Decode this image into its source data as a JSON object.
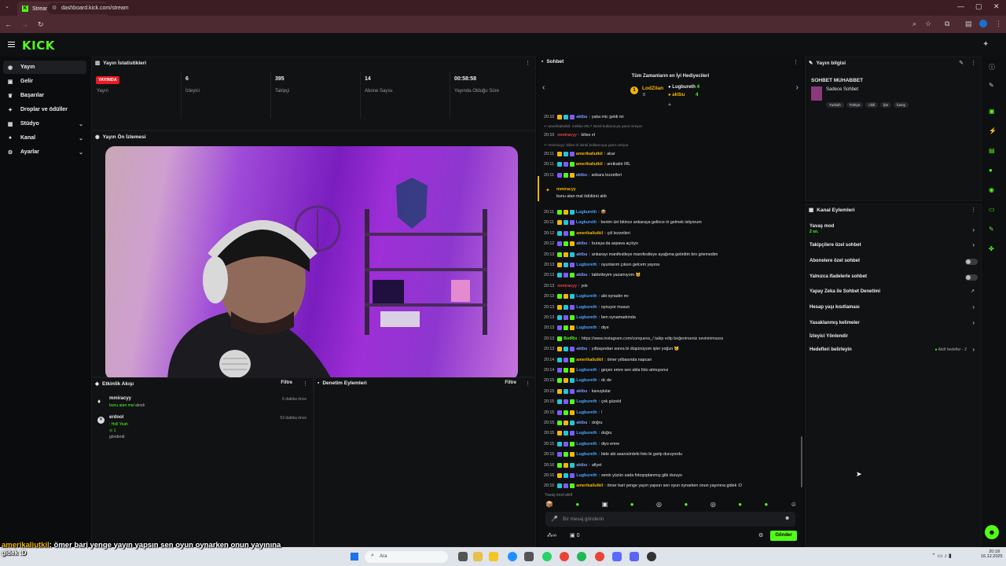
{
  "browser": {
    "tab_title": "Stream - Kick Dashboard",
    "url": "dashboard.kick.com/stream"
  },
  "brand": {
    "logo": "KICK",
    "accent": "#53fc18"
  },
  "sidebar": {
    "items": [
      {
        "label": "Yayın",
        "icon": "broadcast-icon"
      },
      {
        "label": "Gelir",
        "icon": "wallet-icon"
      },
      {
        "label": "Başarılar",
        "icon": "trophy-icon"
      },
      {
        "label": "Droplar ve ödüller",
        "icon": "gift-icon"
      },
      {
        "label": "Stüdyo",
        "icon": "studio-icon"
      },
      {
        "label": "Kanal",
        "icon": "user-icon"
      },
      {
        "label": "Ayarlar",
        "icon": "gear-icon"
      }
    ]
  },
  "stats": {
    "title": "Yayın İstatistikleri",
    "live_badge": "YAYINDA",
    "items": [
      {
        "value": "",
        "label": "Yayın"
      },
      {
        "value": "6",
        "label": "İzleyici"
      },
      {
        "value": "395",
        "label": "Takipçi"
      },
      {
        "value": "14",
        "label": "Abone Sayısı"
      },
      {
        "value": "00:58:58",
        "label": "Yayında Olduğu Süre"
      }
    ]
  },
  "preview": {
    "title": "Yayın Ön İzlemesi"
  },
  "activity": {
    "title": "Etkinlik Akışı",
    "filter": "Filtre",
    "events": [
      {
        "user": "mmiracyy",
        "detail": "bunu atan mal",
        "tail": "alındı",
        "time": "6 dakika önce"
      },
      {
        "user": "erdool",
        "detail": ": Hell Yeah",
        "amount": "1",
        "tail": "gönderdi",
        "time": "53 dakika önce"
      }
    ]
  },
  "moderation": {
    "title": "Denetim Eylemleri",
    "filter": "Filtre"
  },
  "chat": {
    "title": "Sohbet",
    "top_gifters_title": "Tüm Zamanların en İyi Hediyecileri",
    "gifters": [
      {
        "rank": "1",
        "name": "LodZilan",
        "count": "8"
      },
      {
        "name": "Lugbureth",
        "count": "4"
      },
      {
        "name": "aktbu",
        "count": "4"
      }
    ],
    "messages": [
      {
        "t": "20:10",
        "u": "aktbu",
        "c": "#7b9cff",
        "m": "yaka mic geldi mi"
      },
      {
        "sys": "amerikaliutkil: mekke IRL? İsimli kullanıcıya yanıt veriyor"
      },
      {
        "t": "20:10",
        "u": "mmiracyy",
        "c": "#e0433f",
        "m": "kilise ırl"
      },
      {
        "sys": "mmiracyy: kilise irl isimli kullanıcıya yanıt veriyor"
      },
      {
        "t": "20:11",
        "u": "amerikaliutkil",
        "c": "#f2b705",
        "m": "akar"
      },
      {
        "t": "20:11",
        "u": "amerikaliutkil",
        "c": "#f2b705",
        "m": "anıtkabir IRL"
      },
      {
        "t": "20:11",
        "u": "aktbu",
        "c": "#7b9cff",
        "m": "ankara lezzetleri"
      },
      {
        "t": "20:11",
        "u": "Lugbureth",
        "c": "#4aa3ff",
        "m": "📦"
      },
      {
        "t": "20:11",
        "u": "Lugbureth",
        "c": "#4aa3ff",
        "m": "benim ünl bitince ankaraya gelince iri gelmek istiyorum"
      },
      {
        "t": "20:12",
        "u": "amerikaliutkil",
        "c": "#f2b705",
        "m": "çöl lezzetleri"
      },
      {
        "t": "20:12",
        "u": "aktbu",
        "c": "#7b9cff",
        "m": "buraya da aspava açılıyo"
      },
      {
        "t": "20:13",
        "u": "aktbu",
        "c": "#7b9cff",
        "m": "ankarayı manifestleye manıfestleye ayağıma getirdim brn griemedim"
      },
      {
        "t": "20:13",
        "u": "Lugbureth",
        "c": "#4aa3ff",
        "m": "oyunlarım çıksın gelcem yayına"
      },
      {
        "t": "20:13",
        "u": "aktbu",
        "c": "#7b9cff",
        "m": "tabletteyim yazamıyom 🐱"
      },
      {
        "t": "20:13",
        "u": "mmiracyy",
        "c": "#e0433f",
        "m": "yok"
      },
      {
        "t": "20:13",
        "u": "Lugbureth",
        "c": "#4aa3ff",
        "m": "abi oynadın mı"
      },
      {
        "t": "20:13",
        "u": "Lugbureth",
        "c": "#4aa3ff",
        "m": "oynuyor musun"
      },
      {
        "t": "20:13",
        "u": "Lugbureth",
        "c": "#4aa3ff",
        "m": "ben oynamadımda"
      },
      {
        "t": "20:13",
        "u": "Lugbureth",
        "c": "#4aa3ff",
        "m": "diye"
      },
      {
        "t": "20:13",
        "u": "BotRix",
        "c": "#53fc18",
        "m": "https://www.instagram.com/conquess_/ takip edip beğenirseniz sevinirimssss"
      },
      {
        "t": "20:13",
        "u": "aktbu",
        "c": "#7b9cff",
        "m": "yılbaşından sonra bi düşünüyom işler yoğun 🐱"
      },
      {
        "t": "20:14",
        "u": "amerikaliutkil",
        "c": "#f2b705",
        "m": "ömer yılbasında napcan"
      },
      {
        "t": "20:14",
        "u": "Lugbureth",
        "c": "#4aa3ff",
        "m": "geçen emre sen abla foto atmışsınız"
      },
      {
        "t": "20:15",
        "u": "Lugbureth",
        "c": "#4aa3ff",
        "m": "dc de"
      },
      {
        "t": "20:15",
        "u": "aktbu",
        "c": "#7b9cff",
        "m": "kavuştular"
      },
      {
        "t": "20:15",
        "u": "Lugbureth",
        "c": "#4aa3ff",
        "m": "çok güzeld"
      },
      {
        "t": "20:15",
        "u": "Lugbureth",
        "c": "#4aa3ff",
        "m": "!"
      },
      {
        "t": "20:15",
        "u": "aktbu",
        "c": "#7b9cff",
        "m": "doğru"
      },
      {
        "t": "20:15",
        "u": "Lugbureth",
        "c": "#4aa3ff",
        "m": "doğru"
      },
      {
        "t": "20:15",
        "u": "Lugbureth",
        "c": "#4aa3ff",
        "m": "diyo emre"
      },
      {
        "t": "20:15",
        "u": "Lugbureth",
        "c": "#4aa3ff",
        "m": "bide abi asansördeki foto bi garip duruyordu"
      },
      {
        "t": "20:16",
        "u": "aktbu",
        "c": "#7b9cff",
        "m": "afiyet"
      },
      {
        "t": "20:16",
        "u": "Lugbureth",
        "c": "#4aa3ff",
        "m": "senin yüzün sada fotoşoplanmış gibi duruyo"
      },
      {
        "t": "20:16",
        "u": "amerikaliutkil",
        "c": "#f2b705",
        "m": "ömer bari yenge yayın yapsın sen oyun oynarken onun yayınına gidek :D"
      }
    ],
    "gift_user": "mmiracyy",
    "gift_text": "bunu atan mal ödülünü aldı",
    "slow_notice": "Yavaş mod aktif",
    "input_placeholder": "Bir mesaj gönderin",
    "points": "0",
    "send": "Gönder"
  },
  "info": {
    "title": "Yayın bilgisi",
    "stream_title": "SOHBET MUHABBET",
    "category": "Sadece Sohbet",
    "tags": [
      "Turkish",
      "Türkçe",
      "chill",
      "fps",
      "funny"
    ]
  },
  "actions": {
    "title": "Kanal Eylemleri",
    "items": [
      {
        "label": "Yavaş mod",
        "sub": "2 sn."
      },
      {
        "label": "Takipçilere özel sohbet"
      },
      {
        "label": "Abonelere özel sohbet"
      },
      {
        "label": "Yalnızca ifadelerle sohbet"
      },
      {
        "label": "Yapay Zeka ile Sohbet Denetimi"
      },
      {
        "label": "Hesap yaşı kısıtlaması"
      },
      {
        "label": "Yasaklanmış kelimeler"
      },
      {
        "label": "İzleyici Yönlendir"
      },
      {
        "label": "Hedefleri belirleyin",
        "badge": "Aktif hedefler - 2"
      }
    ]
  },
  "overlay": {
    "user": "amerikaliutkil",
    "text": ": ömer bari yenge yayın yapsın sen oyun oynarken onun yayınına",
    "line2": "gidek :D"
  },
  "taskbar": {
    "search": "Ara",
    "time": "20:18",
    "date": "16.12.2025"
  }
}
